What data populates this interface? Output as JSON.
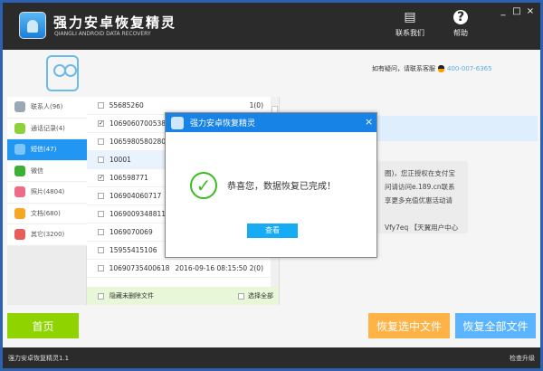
{
  "app": {
    "title": "强力安卓恢复精灵",
    "subtitle": "QIANGLI ANDROID DATA RECOVERY",
    "contact_label": "联系我们",
    "help_label": "帮助",
    "min": "_",
    "max": "□",
    "close": "×"
  },
  "support": {
    "text": "如有疑问，请联系客服",
    "phone": "400-007-6365"
  },
  "sidebar": {
    "items": [
      {
        "label": "联系人(96)",
        "color": "#9aa7b4"
      },
      {
        "label": "通话记录(4)",
        "color": "#8fd13a"
      },
      {
        "label": "短信(47)",
        "color": "#5ab4f0"
      },
      {
        "label": "微信",
        "color": "#3cb034"
      },
      {
        "label": "照片(4804)",
        "color": "#f06a8a"
      },
      {
        "label": "文档(680)",
        "color": "#f5a623"
      },
      {
        "label": "其它(3200)",
        "color": "#e85c5c"
      }
    ]
  },
  "list": {
    "rows": [
      {
        "number": "55685260",
        "date": "",
        "count": "1(0)",
        "checked": false
      },
      {
        "number": "10690607005381",
        "date": "",
        "count": "",
        "checked": true
      },
      {
        "number": "1065980580280...",
        "date": "",
        "count": "",
        "checked": false
      },
      {
        "number": "10001",
        "date": "",
        "count": "",
        "checked": false
      },
      {
        "number": "106598771",
        "date": "",
        "count": "",
        "checked": true
      },
      {
        "number": "106904060717",
        "date": "",
        "count": "",
        "checked": false
      },
      {
        "number": "1069009348811...",
        "date": "",
        "count": "",
        "checked": false
      },
      {
        "number": "1069070069",
        "date": "",
        "count": "",
        "checked": false
      },
      {
        "number": "15955415106",
        "date": "",
        "count": "",
        "checked": false
      },
      {
        "number": "10690735400618",
        "date": "2016-09-16 08:15:50",
        "count": "2(0)",
        "checked": false
      }
    ],
    "hide_label": "隐藏未删除文件",
    "select_all_label": "选择全部"
  },
  "message": {
    "lines": [
      "圈)，您正授权在支付宝",
      "问请访问e.189.cn联系",
      "享更多充值优惠活动请",
      "",
      "Vfy7eq 【天翼用户中心"
    ]
  },
  "buttons": {
    "home": "首页",
    "recover_selected": "恢复选中文件",
    "recover_all": "恢复全部文件"
  },
  "footer": {
    "version": "强力安卓恢复精灵1.1",
    "update": "检查升级"
  },
  "dialog": {
    "title": "强力安卓恢复精灵",
    "message": "恭喜您，数据恢复已完成！",
    "ok": "查看",
    "close": "×"
  }
}
